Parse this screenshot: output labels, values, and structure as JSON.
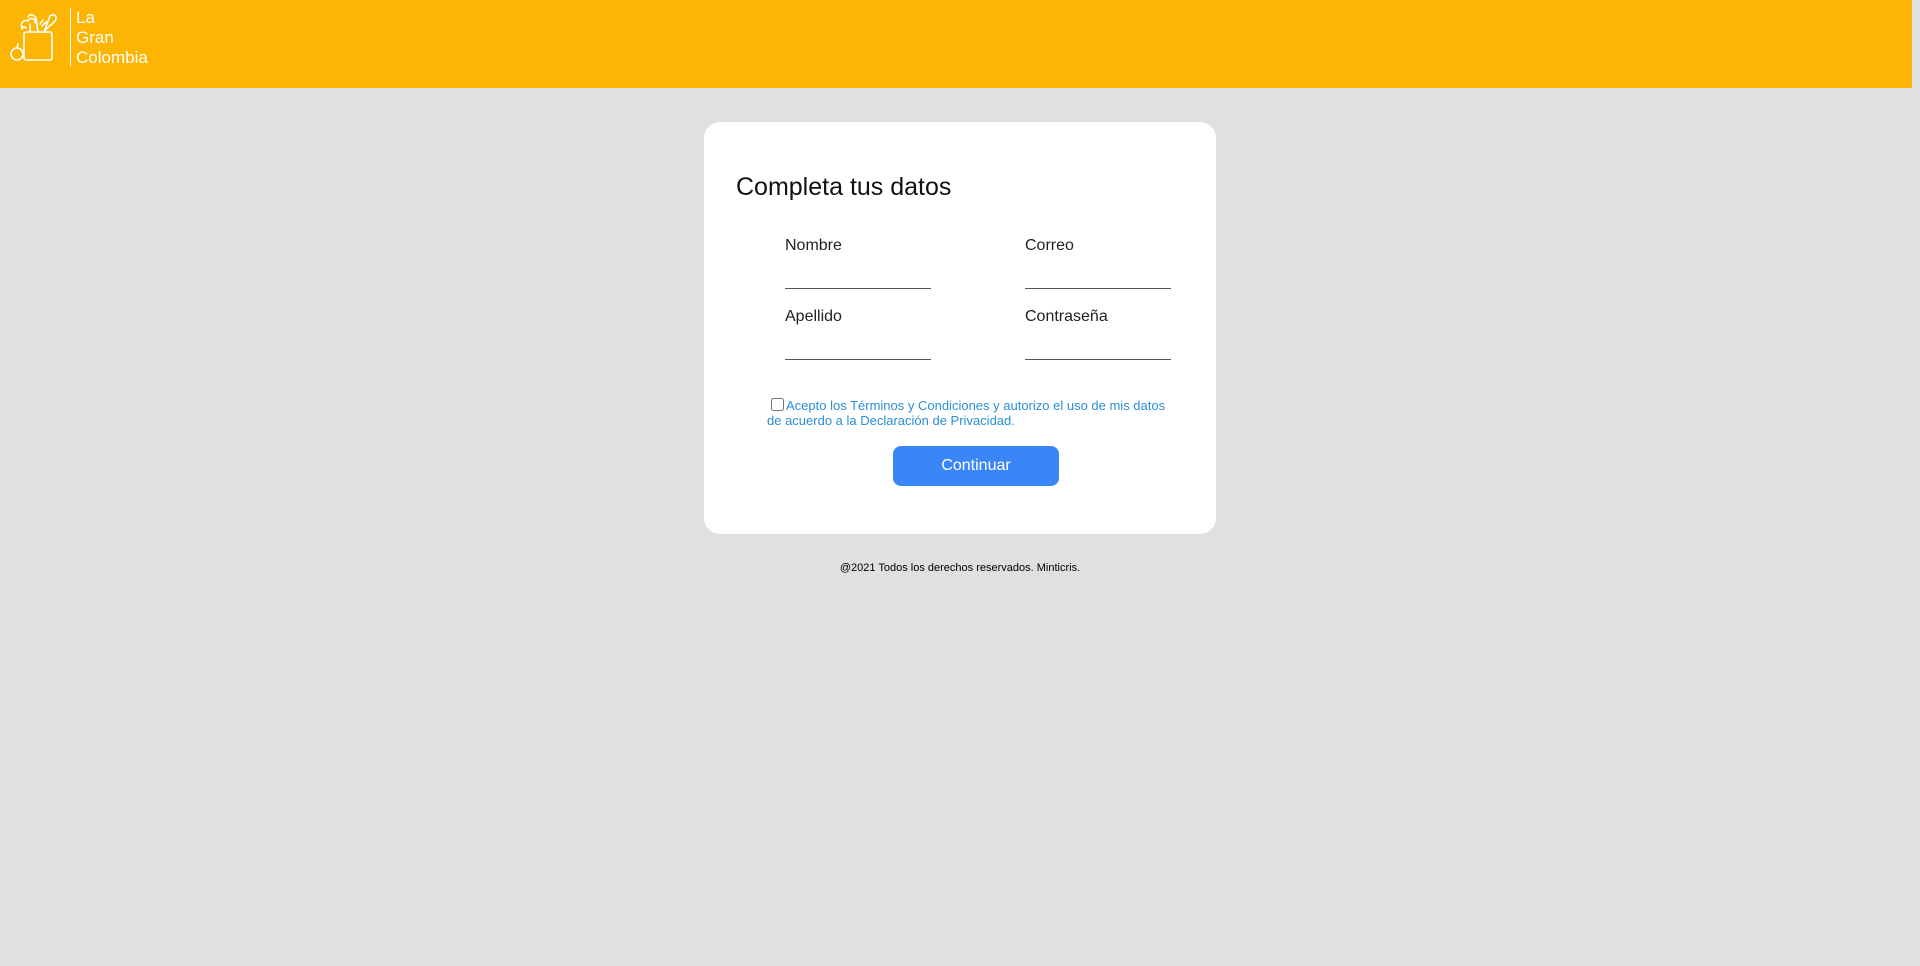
{
  "header": {
    "logo_lines": [
      "La",
      "Gran",
      "Colombia"
    ]
  },
  "form": {
    "title": "Completa tus datos",
    "fields": {
      "nombre": {
        "label": "Nombre",
        "value": ""
      },
      "correo": {
        "label": "Correo",
        "value": ""
      },
      "apellido": {
        "label": "Apellido",
        "value": ""
      },
      "contrasena": {
        "label": "Contraseña",
        "value": ""
      }
    },
    "terms_text": "Acepto los Términos y Condiciones y autorizo el uso de mis datos de acuerdo a la Declaración de Privacidad.",
    "terms_checked": false,
    "submit_label": "Continuar"
  },
  "footer": {
    "text": "@2021 Todos los derechos reservados. Minticris."
  },
  "colors": {
    "header_bg": "#fcb503",
    "page_bg": "#e0e0e0",
    "card_bg": "#ffffff",
    "button_bg": "#3a86f7",
    "link_color": "#2a8fd6"
  },
  "icons": {
    "logo": "grocery-bag-icon"
  }
}
